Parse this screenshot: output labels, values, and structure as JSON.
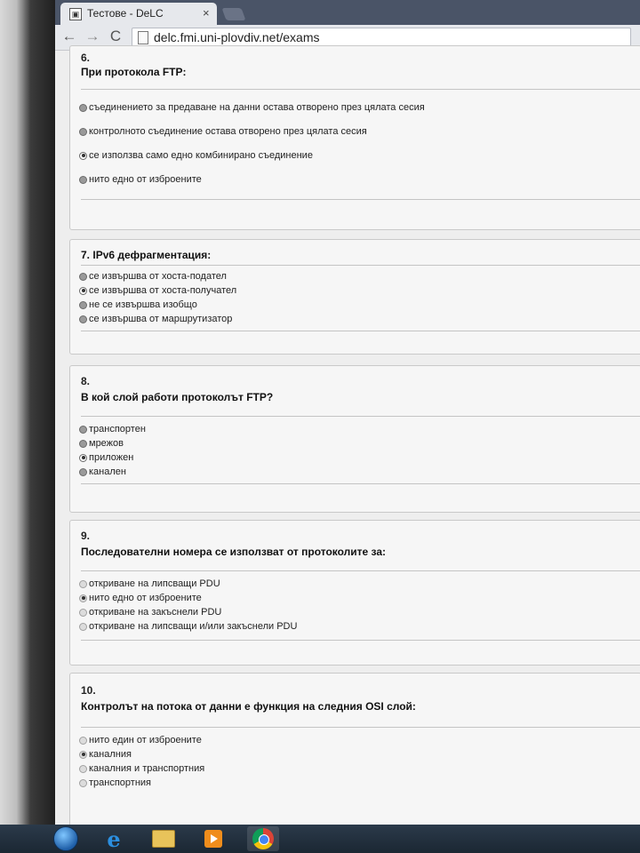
{
  "browser": {
    "tab_title": "Тестове - DeLC",
    "tab_close": "×",
    "url": "delc.fmi.uni-plovdiv.net/exams",
    "back": "←",
    "forward": "→",
    "reload": "C"
  },
  "questions": [
    {
      "number": "6.",
      "text": "При протокола FTP:",
      "options": [
        {
          "label": "съединението за предаване на данни остава отворено през цялата сесия",
          "checked": false
        },
        {
          "label": "контролното съединение остава отворено през цялата сесия",
          "checked": false
        },
        {
          "label": "се използва само едно комбинирано съединение",
          "checked": true
        },
        {
          "label": "нито едно от изброените",
          "checked": false
        }
      ]
    },
    {
      "number": "7.",
      "text": "IPv6 дефрагментация:",
      "options": [
        {
          "label": "се извършва от хоста-подател",
          "checked": false
        },
        {
          "label": "се извършва от хоста-получател",
          "checked": true
        },
        {
          "label": "не се извършва изобщо",
          "checked": false
        },
        {
          "label": "се извършва от маршрутизатор",
          "checked": false
        }
      ]
    },
    {
      "number": "8.",
      "text": "В кой слой работи протоколът FTP?",
      "options": [
        {
          "label": "транспортен",
          "checked": false
        },
        {
          "label": "мрежов",
          "checked": false
        },
        {
          "label": "приложен",
          "checked": true
        },
        {
          "label": "канален",
          "checked": false
        }
      ]
    },
    {
      "number": "9.",
      "text": "Последователни номера се използват от протоколите за:",
      "options": [
        {
          "label": "откриване на липсващи PDU",
          "checked": false
        },
        {
          "label": "нито едно от изброените",
          "checked": true
        },
        {
          "label": "откриване на закъснели PDU",
          "checked": false
        },
        {
          "label": "откриване на липсващи и/или закъснели PDU",
          "checked": false
        }
      ]
    },
    {
      "number": "10.",
      "text": "Контролът на потока от данни е функция на следния OSI слой:",
      "options": [
        {
          "label": "нито един от изброените",
          "checked": false
        },
        {
          "label": "каналния",
          "checked": true
        },
        {
          "label": "каналния и транспортния",
          "checked": false
        },
        {
          "label": "транспортния",
          "checked": false
        }
      ]
    }
  ],
  "taskbar": {
    "icons": [
      "windows-start-icon",
      "internet-explorer-icon",
      "file-explorer-icon",
      "media-player-icon",
      "chrome-icon"
    ],
    "ie_glyph": "e"
  }
}
